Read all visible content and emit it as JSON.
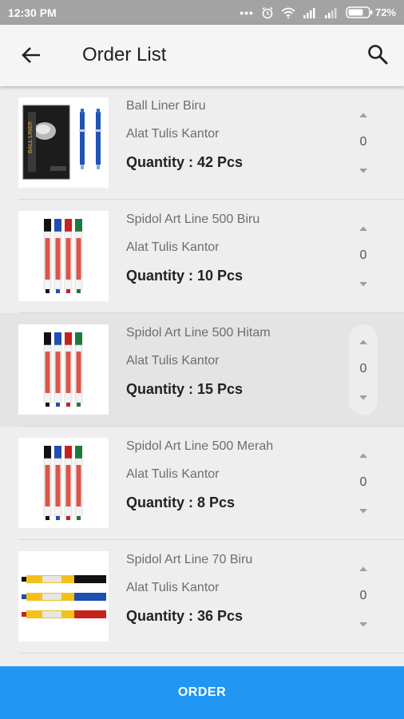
{
  "status_bar": {
    "time": "12:30 PM",
    "dots": "•••",
    "battery_percent": "72%",
    "icons": [
      "alarm-icon",
      "wifi-icon",
      "signal-icon",
      "signal-icon",
      "battery-icon"
    ]
  },
  "app_bar": {
    "title": "Order List",
    "back_icon": "arrow-left-icon",
    "search_icon": "search-icon"
  },
  "items": [
    {
      "name": "Ball Liner Biru",
      "category": "Alat Tulis Kantor",
      "quantity_label": "Quantity : 42 Pcs",
      "stepper_value": "0",
      "image": "ball-liner-pens"
    },
    {
      "name": "Spidol Art Line 500 Biru",
      "category": "Alat Tulis Kantor",
      "quantity_label": "Quantity : 10 Pcs",
      "stepper_value": "0",
      "image": "artline-500-markers"
    },
    {
      "name": "Spidol Art Line 500 Hitam",
      "category": "Alat Tulis Kantor",
      "quantity_label": "Quantity : 15 Pcs",
      "stepper_value": "0",
      "image": "artline-500-markers"
    },
    {
      "name": "Spidol Art Line 500 Merah",
      "category": "Alat Tulis Kantor",
      "quantity_label": "Quantity : 8 Pcs",
      "stepper_value": "0",
      "image": "artline-500-markers"
    },
    {
      "name": "Spidol Art Line 70 Biru",
      "category": "Alat Tulis Kantor",
      "quantity_label": "Quantity : 36 Pcs",
      "stepper_value": "0",
      "image": "artline-70-markers"
    }
  ],
  "order_button": {
    "label": "ORDER"
  },
  "colors": {
    "accent": "#2196f3",
    "status_bar": "#a3a3a3",
    "app_bar": "#f5f5f5",
    "background": "#eeeeee"
  }
}
